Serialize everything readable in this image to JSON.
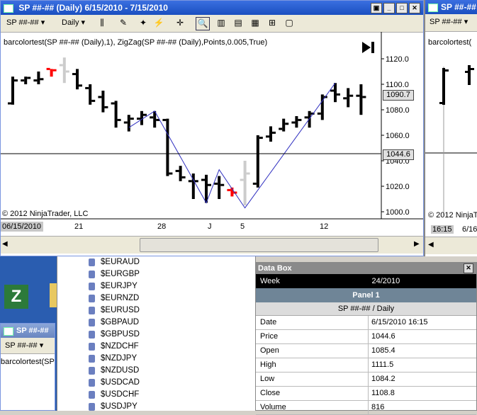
{
  "main_window": {
    "title": "SP ##-## (Daily)  6/15/2010 - 7/15/2010",
    "instrument_combo": "SP ##-##",
    "period_combo": "Daily",
    "indicator_label": "barcolortest(SP ##-## (Daily),1), ZigZag(SP ##-## (Daily),Points,0.005,True)",
    "copyright": "© 2012 NinjaTrader, LLC",
    "current_date_label": "06/15/2010",
    "date_ticks": [
      "21",
      "28",
      "J",
      "5",
      "12"
    ],
    "price_ticks": [
      "1120.0",
      "1100.0",
      "1080.0",
      "1060.0",
      "1040.0",
      "1020.0",
      "1000.0"
    ],
    "price_tag_last": "1090.7",
    "price_tag_cursor": "1044.6"
  },
  "right_window": {
    "title": "SP ##-##",
    "instrument_combo": "SP ##-##",
    "indicator_label": "barcolortest(",
    "copyright": "© 2012 NinjaT",
    "date_labels": [
      "16:15",
      "6/16"
    ]
  },
  "small_window": {
    "title": "SP ##-##",
    "instrument_combo": "SP ##-##",
    "indicator_label": "barcolortest(SP"
  },
  "symbols": [
    "$EURAUD",
    "$EURGBP",
    "$EURJPY",
    "$EURNZD",
    "$EURUSD",
    "$GBPAUD",
    "$GBPUSD",
    "$NZDCHF",
    "$NZDJPY",
    "$NZDUSD",
    "$USDCAD",
    "$USDCHF",
    "$USDJPY"
  ],
  "data_box": {
    "title": "Data Box",
    "week_label": "Week",
    "week_value": "24/2010",
    "panel": "Panel 1",
    "instrument": "SP ##-## / Daily",
    "rows": [
      {
        "k": "Date",
        "v": "6/15/2010 16:15"
      },
      {
        "k": "Price",
        "v": "1044.6"
      },
      {
        "k": "Open",
        "v": "1085.4"
      },
      {
        "k": "High",
        "v": "1111.5"
      },
      {
        "k": "Low",
        "v": "1084.2"
      },
      {
        "k": "Close",
        "v": "1108.8"
      },
      {
        "k": "Volume",
        "v": "816"
      }
    ]
  },
  "chart_data": {
    "type": "ohlc",
    "ylim": [
      1000,
      1120
    ],
    "colors": {
      "normal": "#000000",
      "down_signal": "#ff0000",
      "ghost": "#cccccc",
      "zigzag": "#3030c0"
    },
    "bars": [
      {
        "o": 1085,
        "h": 1106,
        "l": 1084,
        "c": 1103,
        "color": "normal"
      },
      {
        "o": 1103,
        "h": 1106,
        "l": 1100,
        "c": 1105,
        "color": "normal"
      },
      {
        "o": 1103,
        "h": 1110,
        "l": 1100,
        "c": 1104,
        "color": "normal"
      },
      {
        "o": 1112,
        "h": 1112,
        "l": 1106,
        "c": 1111,
        "color": "down_signal"
      },
      {
        "o": 1115,
        "h": 1121,
        "l": 1101,
        "c": 1110,
        "color": "ghost"
      },
      {
        "o": 1108,
        "h": 1112,
        "l": 1096,
        "c": 1099,
        "color": "normal"
      },
      {
        "o": 1097,
        "h": 1100,
        "l": 1084,
        "c": 1087,
        "color": "normal"
      },
      {
        "o": 1090,
        "h": 1095,
        "l": 1078,
        "c": 1082,
        "color": "normal"
      },
      {
        "o": 1085,
        "h": 1087,
        "l": 1066,
        "c": 1072,
        "color": "normal"
      },
      {
        "o": 1070,
        "h": 1076,
        "l": 1063,
        "c": 1073,
        "color": "normal"
      },
      {
        "o": 1073,
        "h": 1079,
        "l": 1068,
        "c": 1076,
        "color": "normal"
      },
      {
        "o": 1074,
        "h": 1079,
        "l": 1066,
        "c": 1072,
        "color": "normal"
      },
      {
        "o": 1072,
        "h": 1073,
        "l": 1028,
        "c": 1030,
        "color": "normal"
      },
      {
        "o": 1032,
        "h": 1036,
        "l": 1024,
        "c": 1027,
        "color": "normal"
      },
      {
        "o": 1024,
        "h": 1030,
        "l": 1010,
        "c": 1024,
        "color": "normal"
      },
      {
        "o": 1025,
        "h": 1029,
        "l": 1007,
        "c": 1021,
        "color": "normal"
      },
      {
        "o": 1022,
        "h": 1028,
        "l": 1010,
        "c": 1021,
        "color": "normal"
      },
      {
        "o": 1017,
        "h": 1019,
        "l": 1012,
        "c": 1015,
        "color": "down_signal"
      },
      {
        "o": 1025,
        "h": 1040,
        "l": 1005,
        "c": 1030,
        "color": "ghost"
      },
      {
        "o": 1022,
        "h": 1060,
        "l": 1019,
        "c": 1058,
        "color": "normal"
      },
      {
        "o": 1059,
        "h": 1067,
        "l": 1055,
        "c": 1062,
        "color": "normal"
      },
      {
        "o": 1065,
        "h": 1073,
        "l": 1063,
        "c": 1069,
        "color": "normal"
      },
      {
        "o": 1070,
        "h": 1075,
        "l": 1066,
        "c": 1072,
        "color": "normal"
      },
      {
        "o": 1074,
        "h": 1079,
        "l": 1066,
        "c": 1077,
        "color": "normal"
      },
      {
        "o": 1077,
        "h": 1092,
        "l": 1072,
        "c": 1090,
        "color": "normal"
      },
      {
        "o": 1095,
        "h": 1101,
        "l": 1086,
        "c": 1092,
        "color": "normal"
      },
      {
        "o": 1089,
        "h": 1097,
        "l": 1082,
        "c": 1091,
        "color": "normal"
      },
      {
        "o": 1091,
        "h": 1100,
        "l": 1076,
        "c": 1090,
        "color": "normal"
      }
    ],
    "zigzag": [
      {
        "bar": 9,
        "price": 1066
      },
      {
        "bar": 11,
        "price": 1079
      },
      {
        "bar": 15,
        "price": 1007
      },
      {
        "bar": 16,
        "price": 1033
      },
      {
        "bar": 18,
        "price": 1003
      },
      {
        "bar": 25,
        "price": 1101
      }
    ]
  }
}
